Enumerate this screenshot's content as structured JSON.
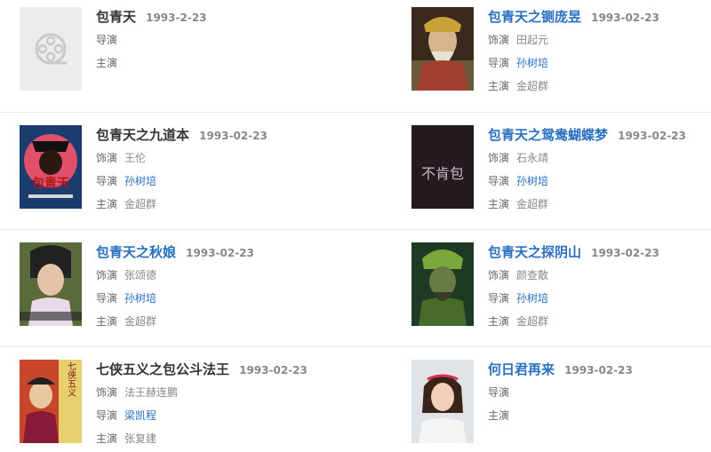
{
  "items": [
    {
      "title": "包青天",
      "date": "1993-2-23",
      "role_label": "",
      "role": "",
      "director_label": "导演",
      "director": "",
      "cast_label": "主演",
      "cast": ""
    },
    {
      "title": "包青天之铡庞昱",
      "date": "1993-02-23",
      "role_label": "饰演",
      "role": "田起元",
      "director_label": "导演",
      "director": "孙树培",
      "cast_label": "主演",
      "cast": "金超群"
    },
    {
      "title": "包青天之九道本",
      "date": "1993-02-23",
      "role_label": "饰演",
      "role": "王伦",
      "director_label": "导演",
      "director": "孙树培",
      "cast_label": "主演",
      "cast": "金超群"
    },
    {
      "title": "包青天之鸳鸯蝴蝶梦",
      "date": "1993-02-23",
      "role_label": "饰演",
      "role": "石永靖",
      "director_label": "导演",
      "director": "孙树培",
      "cast_label": "主演",
      "cast": "金超群"
    },
    {
      "title": "包青天之秋娘",
      "date": "1993-02-23",
      "role_label": "饰演",
      "role": "张颂德",
      "director_label": "导演",
      "director": "孙树培",
      "cast_label": "主演",
      "cast": "金超群"
    },
    {
      "title": "包青天之探阴山",
      "date": "1993-02-23",
      "role_label": "饰演",
      "role": "颜查散",
      "director_label": "导演",
      "director": "孙树培",
      "cast_label": "主演",
      "cast": "金超群"
    },
    {
      "title": "七侠五义之包公斗法王",
      "date": "1993-02-23",
      "role_label": "饰演",
      "role": "法王赫连鹏",
      "director_label": "导演",
      "director": "梁凯程",
      "cast_label": "主演",
      "cast": "张复建"
    },
    {
      "title": "何日君再来",
      "date": "1993-02-23",
      "role_label": "",
      "role": "",
      "director_label": "导演",
      "director": "",
      "cast_label": "主演",
      "cast": ""
    }
  ],
  "poster_texts": {
    "p3": "包青天",
    "p4": "不肯包",
    "p7": "七侠五义"
  },
  "colors": {
    "link": "#2a6fbf",
    "date": "#888888",
    "divider": "#e9e9e9"
  }
}
